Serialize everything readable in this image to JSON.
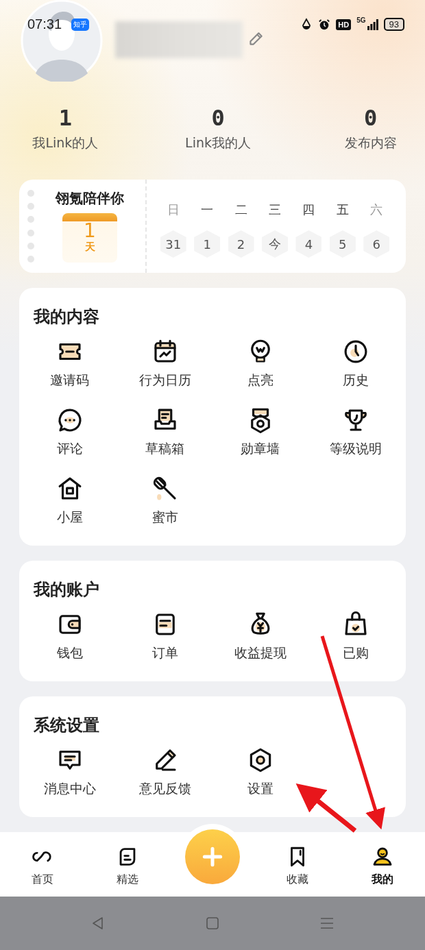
{
  "status_bar": {
    "time": "07:31",
    "app_badge": "知乎",
    "hd": "HD",
    "network": "5G",
    "battery": "93"
  },
  "stats": [
    {
      "value": "1",
      "label": "我Link的人"
    },
    {
      "value": "0",
      "label": "Link我的人"
    },
    {
      "value": "0",
      "label": "发布内容"
    }
  ],
  "streak_card": {
    "title": "翎氪陪伴你",
    "days": "1",
    "unit": "天",
    "weekdays": [
      "日",
      "一",
      "二",
      "三",
      "四",
      "五",
      "六"
    ],
    "dates": [
      "31",
      "1",
      "2",
      "今",
      "4",
      "5",
      "6"
    ]
  },
  "sections": [
    {
      "title": "我的内容",
      "items": [
        {
          "label": "邀请码"
        },
        {
          "label": "行为日历"
        },
        {
          "label": "点亮"
        },
        {
          "label": "历史"
        },
        {
          "label": "评论"
        },
        {
          "label": "草稿箱"
        },
        {
          "label": "勋章墙"
        },
        {
          "label": "等级说明"
        },
        {
          "label": "小屋"
        },
        {
          "label": "蜜市"
        }
      ]
    },
    {
      "title": "我的账户",
      "items": [
        {
          "label": "钱包"
        },
        {
          "label": "订单"
        },
        {
          "label": "收益提现"
        },
        {
          "label": "已购"
        }
      ]
    },
    {
      "title": "系统设置",
      "items": [
        {
          "label": "消息中心"
        },
        {
          "label": "意见反馈"
        },
        {
          "label": "设置"
        }
      ]
    }
  ],
  "bottom_nav": {
    "tabs": [
      {
        "label": "首页",
        "selected": false
      },
      {
        "label": "精选",
        "selected": false
      },
      {
        "label": "收藏",
        "selected": false
      },
      {
        "label": "我的",
        "selected": true
      }
    ]
  }
}
